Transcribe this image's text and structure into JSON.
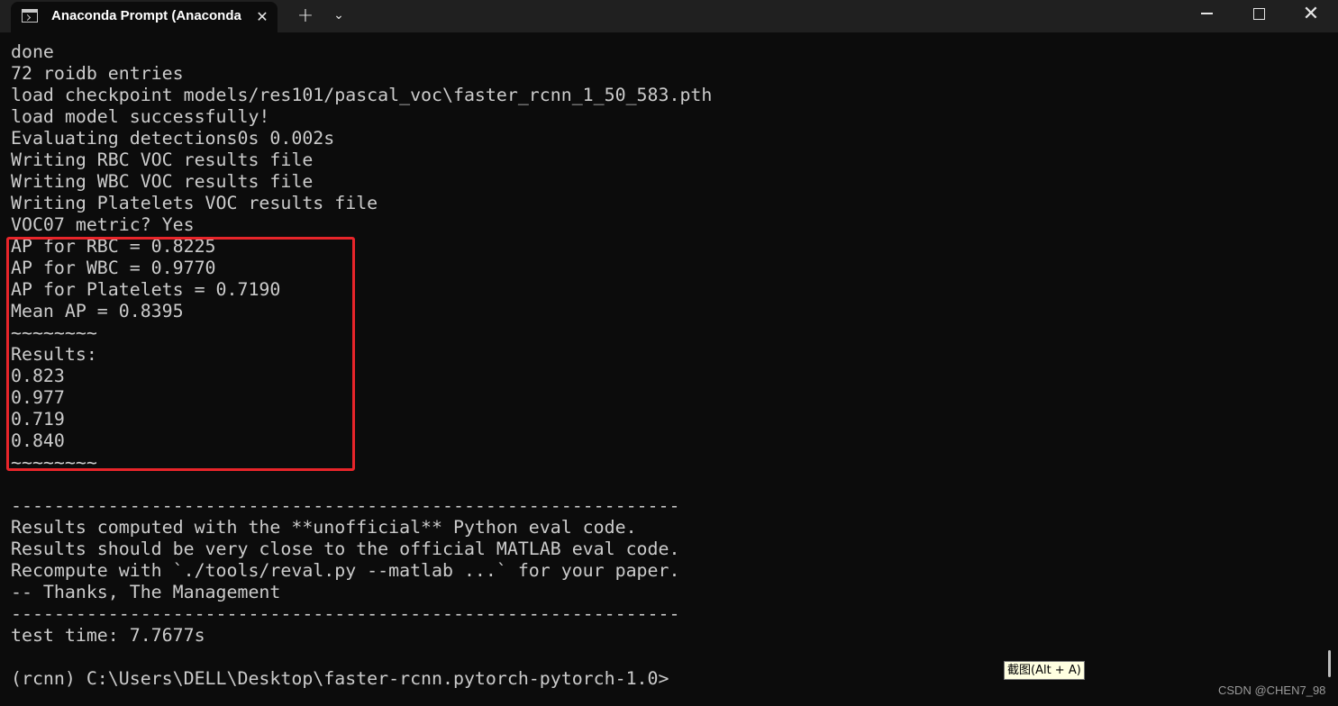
{
  "window": {
    "tab_title": "Anaconda Prompt (Anaconda",
    "tab_close_glyph": "✕",
    "new_tab_glyph": "+",
    "dropdown_glyph": "⌄",
    "close_glyph": "✕"
  },
  "terminal": {
    "lines": [
      "done",
      "72 roidb entries",
      "load checkpoint models/res101/pascal_voc\\faster_rcnn_1_50_583.pth",
      "load model successfully!",
      "Evaluating detections0s 0.002s",
      "Writing RBC VOC results file",
      "Writing WBC VOC results file",
      "Writing Platelets VOC results file",
      "VOC07 metric? Yes",
      "AP for RBC = 0.8225",
      "AP for WBC = 0.9770",
      "AP for Platelets = 0.7190",
      "Mean AP = 0.8395",
      "~~~~~~~~",
      "Results:",
      "0.823",
      "0.977",
      "0.719",
      "0.840",
      "~~~~~~~~",
      "",
      "--------------------------------------------------------------",
      "Results computed with the **unofficial** Python eval code.",
      "Results should be very close to the official MATLAB eval code.",
      "Recompute with `./tools/reval.py --matlab ...` for your paper.",
      "-- Thanks, The Management",
      "--------------------------------------------------------------",
      "test time: 7.7677s",
      "",
      "(rcnn) C:\\Users\\DELL\\Desktop\\faster-rcnn.pytorch-pytorch-1.0>"
    ]
  },
  "overlay": {
    "tooltip": "截图(Alt + A)",
    "watermark": "CSDN @CHEN7_98",
    "highlight_color": "#e8252a"
  }
}
